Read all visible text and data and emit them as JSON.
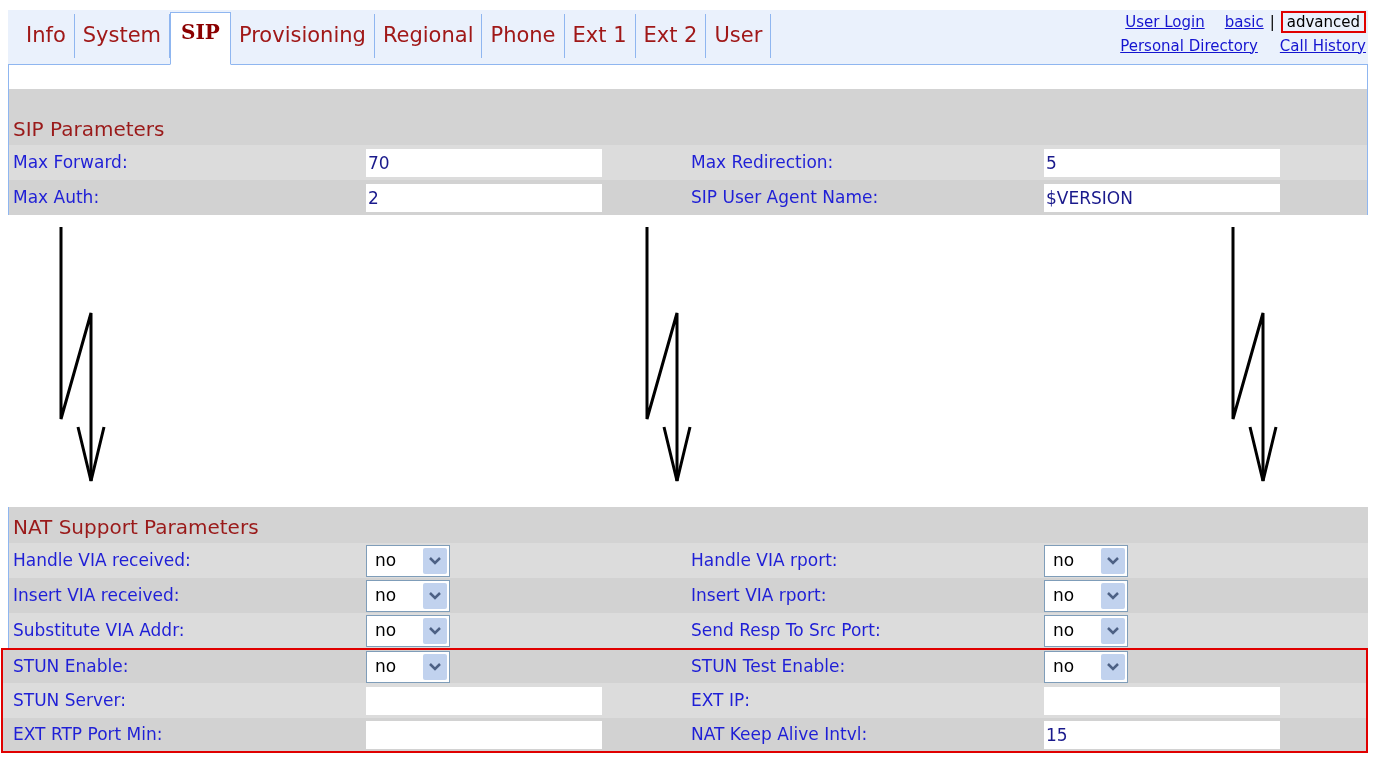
{
  "tabs": [
    {
      "label": "Info",
      "selected": false
    },
    {
      "label": "System",
      "selected": false
    },
    {
      "label": "SIP",
      "selected": true
    },
    {
      "label": "Provisioning",
      "selected": false
    },
    {
      "label": "Regional",
      "selected": false
    },
    {
      "label": "Phone",
      "selected": false
    },
    {
      "label": "Ext 1",
      "selected": false
    },
    {
      "label": "Ext 2",
      "selected": false
    },
    {
      "label": "User",
      "selected": false
    }
  ],
  "header_links": {
    "user_login": "User Login",
    "separator": "|",
    "view_modes": [
      {
        "label": "basic",
        "selected": false
      },
      {
        "label": "advanced",
        "selected": true
      }
    ],
    "personal_directory": "Personal Directory",
    "call_history": "Call History"
  },
  "sections": [
    {
      "title": "SIP Parameters",
      "rows": [
        {
          "highlighted": false,
          "fields": [
            {
              "label": "Max Forward:",
              "kind": "text",
              "value": "70"
            },
            {
              "label": "Max Redirection:",
              "kind": "text",
              "value": "5"
            }
          ]
        },
        {
          "highlighted": false,
          "fields": [
            {
              "label": "Max Auth:",
              "kind": "text",
              "value": "2"
            },
            {
              "label": "SIP User Agent Name:",
              "kind": "text",
              "value": "$VERSION"
            }
          ]
        }
      ]
    },
    {
      "title": "NAT Support Parameters",
      "rows": [
        {
          "highlighted": false,
          "fields": [
            {
              "label": "Handle VIA received:",
              "kind": "select",
              "value": "no"
            },
            {
              "label": "Handle VIA rport:",
              "kind": "select",
              "value": "no"
            }
          ]
        },
        {
          "highlighted": false,
          "fields": [
            {
              "label": "Insert VIA received:",
              "kind": "select",
              "value": "no"
            },
            {
              "label": "Insert VIA rport:",
              "kind": "select",
              "value": "no"
            }
          ]
        },
        {
          "highlighted": false,
          "fields": [
            {
              "label": "Substitute VIA Addr:",
              "kind": "select",
              "value": "no"
            },
            {
              "label": "Send Resp To Src Port:",
              "kind": "select",
              "value": "no"
            }
          ]
        },
        {
          "highlighted": true,
          "fields": [
            {
              "label": "STUN Enable:",
              "kind": "select",
              "value": "no"
            },
            {
              "label": "STUN Test Enable:",
              "kind": "select",
              "value": "no"
            }
          ]
        },
        {
          "highlighted": true,
          "fields": [
            {
              "label": "STUN Server:",
              "kind": "text"
            },
            {
              "label": "EXT IP:",
              "kind": "text"
            }
          ]
        },
        {
          "highlighted": true,
          "fields": [
            {
              "label": "EXT RTP Port Min:",
              "kind": "text"
            },
            {
              "label": "NAT Keep Alive Intvl:",
              "kind": "text",
              "value": "15"
            }
          ]
        }
      ]
    }
  ]
}
